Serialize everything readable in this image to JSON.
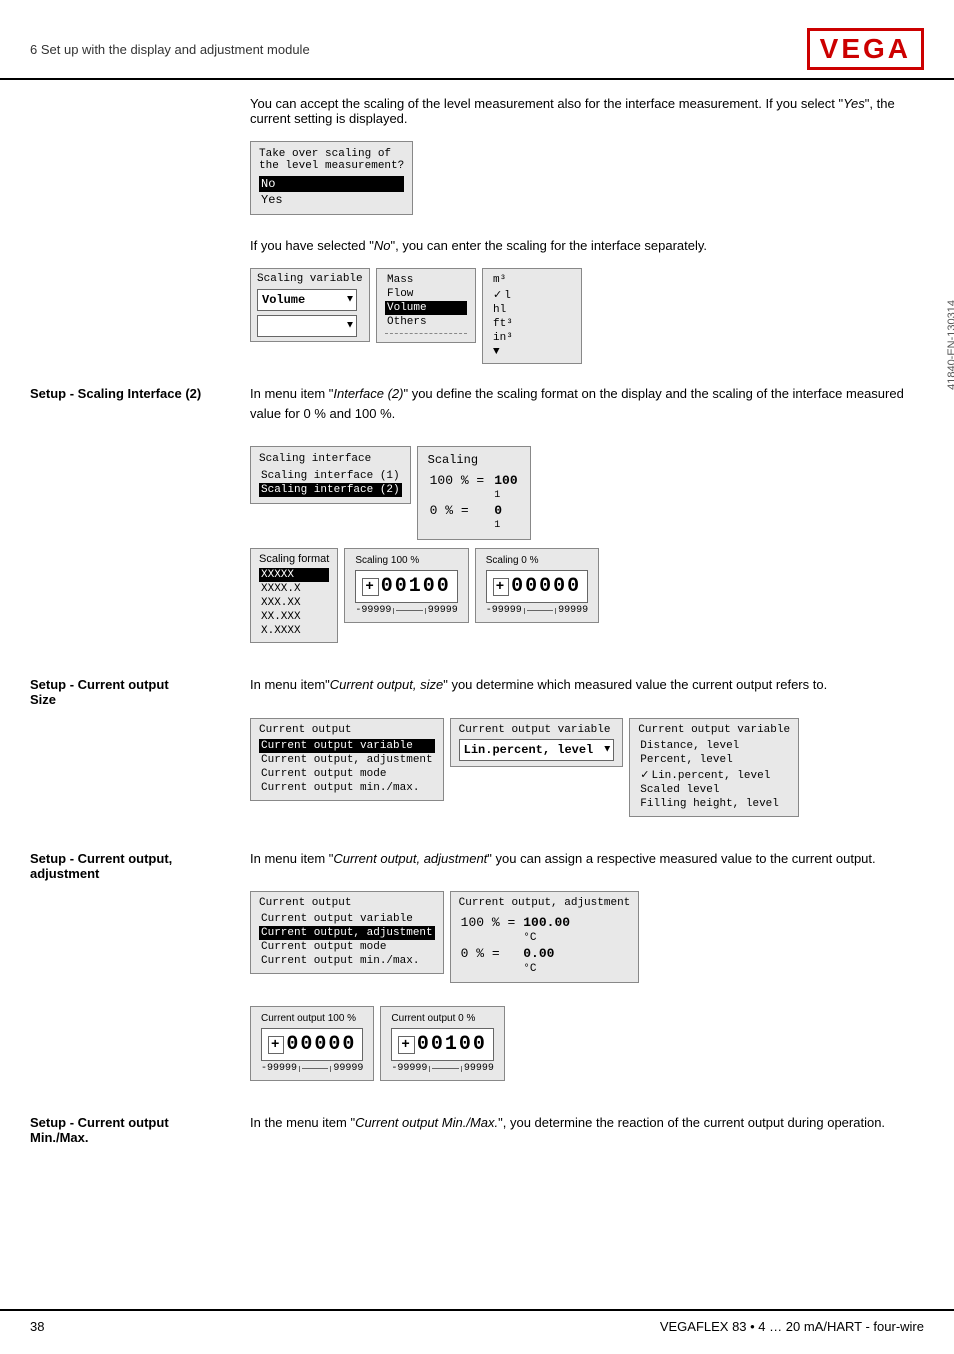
{
  "header": {
    "title": "6 Set up with the display and adjustment module",
    "logo": "VEGA"
  },
  "footer": {
    "page": "38",
    "product": "VEGAFLEX 83 • 4 … 20 mA/HART - four-wire"
  },
  "doc_number": "41840-EN-130314",
  "intro_text": "You can accept the scaling of the level measurement also for the interface measurement. If you select \"Yes\", the current setting is displayed.",
  "take_over_dialog": {
    "title": "Take over scaling of\nthe level measurement?",
    "items": [
      "No",
      "Yes"
    ],
    "selected": "No"
  },
  "no_text": "If you have selected \"No\", you can enter the scaling for the interface separately.",
  "scaling_variable_dialog": {
    "title": "Scaling variable",
    "selected": "Volume",
    "options_col1": [
      "Mass",
      "Flow",
      "Volume",
      "Others"
    ],
    "options_col2": [
      "m³",
      "l",
      "hl",
      "ft³",
      "in³"
    ],
    "selected_col1": "Volume",
    "selected_col2": "l"
  },
  "section_scaling_interface": {
    "label": "Setup - Scaling Interface (2)",
    "text_parts": [
      "In menu item \"",
      "Interface (2)",
      "\" you define the scaling format on the display and the scaling of the interface measured value for 0 % and 100 %."
    ],
    "interface_dialog": {
      "title": "Scaling interface",
      "items": [
        "Scaling interface (1)",
        "Scaling interface (2)"
      ],
      "selected": "Scaling interface (2)"
    },
    "scaling_center": {
      "title": "Scaling",
      "row1_pct": "100 % =",
      "row1_val": "100",
      "row1_sub": "1",
      "row2_pct": "0 % =",
      "row2_val": "0",
      "row2_sub": "1"
    },
    "scaling_format_dialog": {
      "title": "Scaling format",
      "items": [
        "XXXXX",
        "XXXX.X",
        "XXX.XX",
        "XX.XXX",
        "X.XXXX"
      ],
      "selected": "XXXXX"
    },
    "scaling_100": {
      "title": "Scaling 100 %",
      "value": "+00100",
      "range_min": "-99999",
      "range_max": "99999"
    },
    "scaling_0": {
      "title": "Scaling 0 %",
      "value": "+00000",
      "range_min": "-99999",
      "range_max": "99999"
    }
  },
  "section_current_output_size": {
    "label": "Setup - Current output\nSize",
    "text_parts": [
      "In menu item\"",
      "Current output, size",
      "\" you determine which measured value the current output refers to."
    ],
    "current_output_dialog": {
      "title": "Current output",
      "items": [
        "Current output variable",
        "Current output, adjustment",
        "Current output mode",
        "Current output min./max."
      ],
      "selected": "Current output variable"
    },
    "variable_dialog": {
      "title": "Current output variable",
      "selected": "Lin.percent, level",
      "dropdown_label": "Lin.percent, level"
    },
    "variable_list": {
      "title": "Current output variable",
      "items": [
        "Distance, level",
        "Percent, level",
        "Lin.percent, level",
        "Scaled level",
        "Filling height, level"
      ],
      "selected": "Lin.percent, level"
    }
  },
  "section_current_output_adjustment": {
    "label": "Setup - Current output,\nadjustment",
    "text_parts": [
      "In menu item \"",
      "Current output, adjustment",
      "\" you can assign a respective measured value to the current output."
    ],
    "current_output_dialog": {
      "title": "Current output",
      "items": [
        "Current output variable",
        "Current output, adjustment",
        "Current output mode",
        "Current output min./max."
      ],
      "selected": "Current output, adjustment"
    },
    "adjustment_dialog": {
      "title": "Current output, adjustment",
      "row1_pct": "100 % =",
      "row1_val": "100.00",
      "row1_unit": "°C",
      "row2_pct": "0 % =",
      "row2_val": "0.00",
      "row2_unit": "°C"
    },
    "output_100": {
      "title": "Current output 100 %",
      "value": "+00000",
      "range_min": "-99999",
      "range_max": "99999"
    },
    "output_0": {
      "title": "Current output 0 %",
      "value": "+00100",
      "range_min": "-99999",
      "range_max": "99999"
    }
  },
  "section_current_output_minmax": {
    "label": "Setup - Current output\nMin./Max.",
    "text_parts": [
      "In the menu item \"",
      "Current output Min./Max.",
      "\", you determine the reaction of the current output during operation."
    ]
  }
}
